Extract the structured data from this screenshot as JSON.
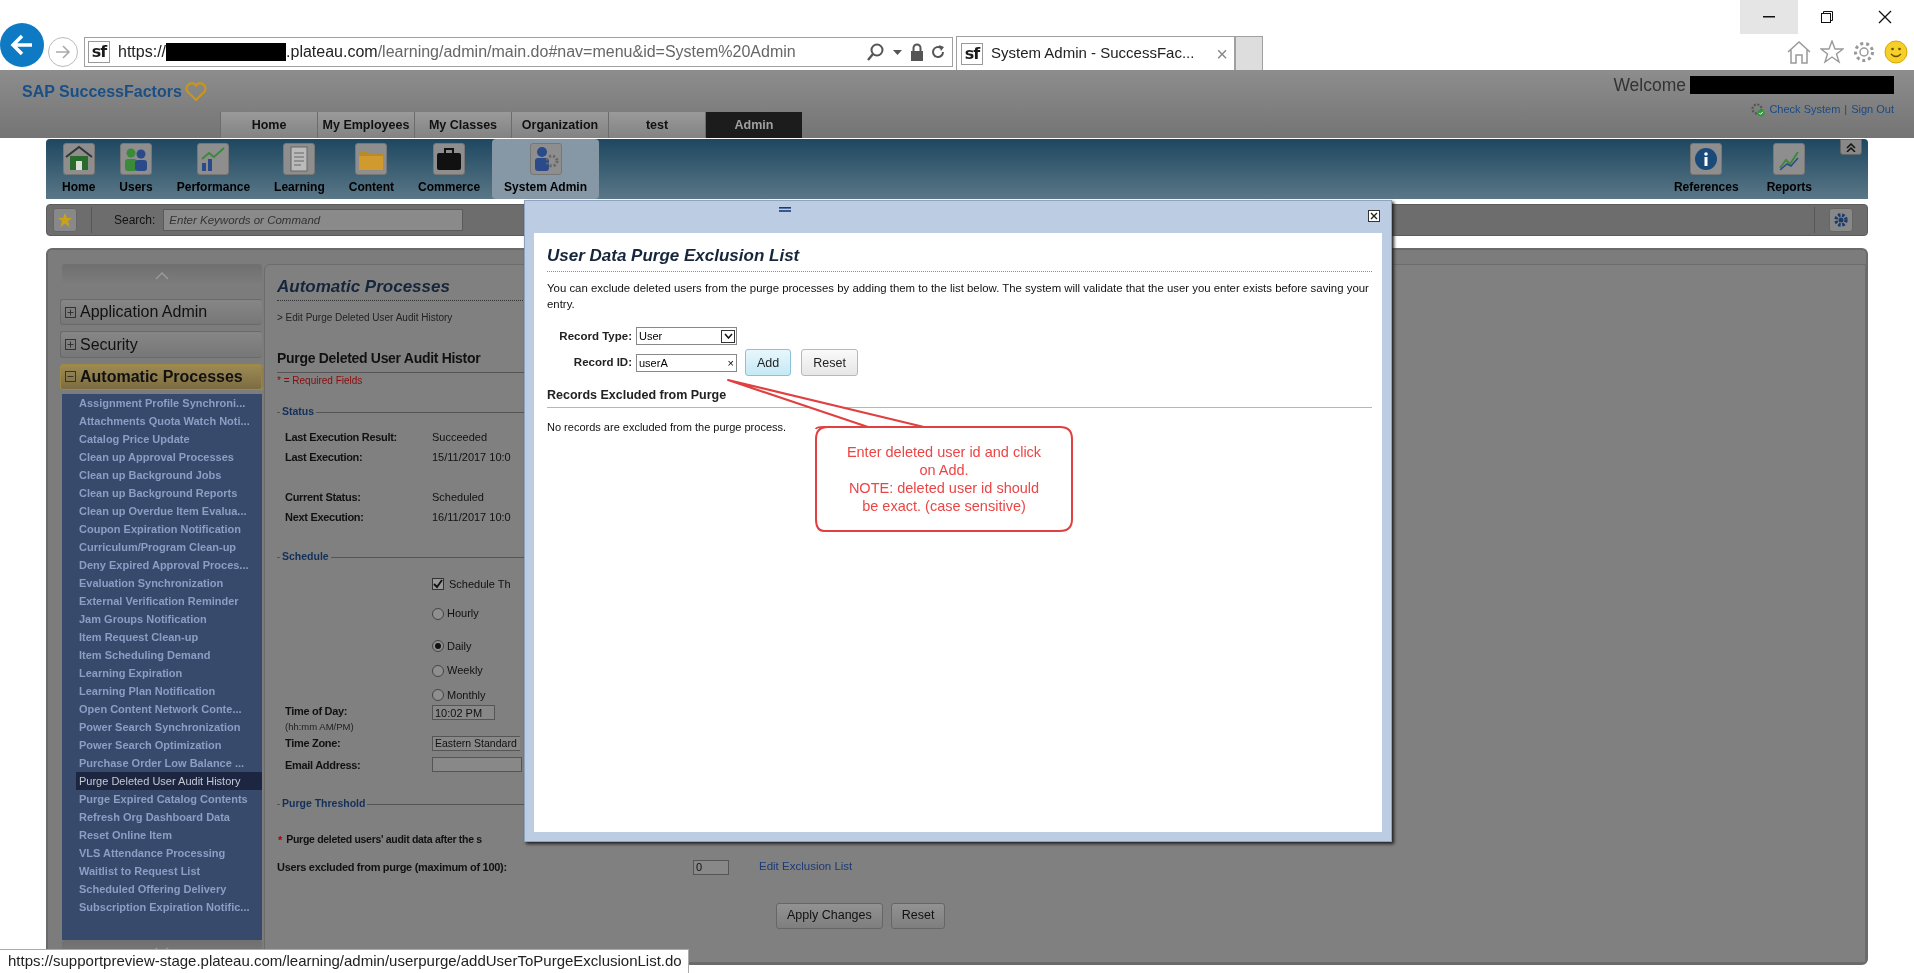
{
  "browser": {
    "address": {
      "site_icon": "sf",
      "scheme": "https://",
      "host": ".plateau.com",
      "path": "/learning/admin/main.do#nav=menu&id=System%20Admin"
    },
    "tabs": [
      {
        "site_icon": "sf",
        "title": "System Admin - SuccessFac...",
        "close": "×",
        "selected": true
      }
    ]
  },
  "header": {
    "logo": "SAP SuccessFactors",
    "welcome": "Welcome",
    "links": [
      "Check System",
      "Sign Out"
    ],
    "separator": "|"
  },
  "nav_tabs": [
    {
      "label": "Home",
      "selected": false
    },
    {
      "label": "My Employees",
      "selected": false
    },
    {
      "label": "My Classes",
      "selected": false
    },
    {
      "label": "Organization",
      "selected": false
    },
    {
      "label": "test",
      "selected": false
    },
    {
      "label": "Admin",
      "selected": true
    }
  ],
  "toolbar": {
    "items": [
      {
        "label": "Home",
        "selected": false
      },
      {
        "label": "Users",
        "selected": false
      },
      {
        "label": "Performance",
        "selected": false
      },
      {
        "label": "Learning",
        "selected": false
      },
      {
        "label": "Content",
        "selected": false
      },
      {
        "label": "Commerce",
        "selected": false
      },
      {
        "label": "System Admin",
        "selected": true
      }
    ],
    "right_items": [
      "References",
      "Reports"
    ]
  },
  "search": {
    "label": "Search:",
    "placeholder": "Enter Keywords or Command"
  },
  "sidebar": {
    "sections": [
      {
        "label": "Application Admin",
        "expanded": false
      },
      {
        "label": "Security",
        "expanded": false
      },
      {
        "label": "Automatic Processes",
        "expanded": true,
        "children": [
          {
            "label": "Assignment Profile Synchroni...",
            "selected": false
          },
          {
            "label": "Attachments Quota Watch Noti...",
            "selected": false
          },
          {
            "label": "Catalog Price Update",
            "selected": false
          },
          {
            "label": "Clean up Approval Processes",
            "selected": false
          },
          {
            "label": "Clean up Background Jobs",
            "selected": false
          },
          {
            "label": "Clean up Background Reports",
            "selected": false
          },
          {
            "label": "Clean up Overdue Item Evalua...",
            "selected": false
          },
          {
            "label": "Coupon Expiration Notification",
            "selected": false
          },
          {
            "label": "Curriculum/Program Clean-up",
            "selected": false
          },
          {
            "label": "Deny Expired Approval Proces...",
            "selected": false
          },
          {
            "label": "Evaluation Synchronization",
            "selected": false
          },
          {
            "label": "External Verification Reminder",
            "selected": false
          },
          {
            "label": "Jam Groups Notification",
            "selected": false
          },
          {
            "label": "Item Request Clean-up",
            "selected": false
          },
          {
            "label": "Item Scheduling Demand",
            "selected": false
          },
          {
            "label": "Learning Expiration",
            "selected": false
          },
          {
            "label": "Learning Plan Notification",
            "selected": false
          },
          {
            "label": "Open Content Network Conte...",
            "selected": false
          },
          {
            "label": "Power Search Synchronization",
            "selected": false
          },
          {
            "label": "Power Search Optimization",
            "selected": false
          },
          {
            "label": "Purchase Order Low Balance ...",
            "selected": false
          },
          {
            "label": "Purge Deleted User Audit History",
            "selected": true
          },
          {
            "label": "Purge Expired Catalog Contents",
            "selected": false
          },
          {
            "label": "Refresh Org Dashboard Data",
            "selected": false
          },
          {
            "label": "Reset Online Item",
            "selected": false
          },
          {
            "label": "VLS Attendance Processing",
            "selected": false
          },
          {
            "label": "Waitlist to Request List",
            "selected": false
          },
          {
            "label": "Scheduled Offering Delivery",
            "selected": false
          },
          {
            "label": "Subscription Expiration Notific...",
            "selected": false
          }
        ]
      }
    ]
  },
  "main": {
    "title": "Automatic Processes",
    "breadcrumb": "> Edit Purge Deleted User Audit History",
    "heading": "Purge Deleted User Audit Histor",
    "required_note": "* = Required Fields",
    "status": {
      "legend": "Status",
      "rows": [
        {
          "label": "Last Execution Result:",
          "value": "Succeeded"
        },
        {
          "label": "Last Execution:",
          "value": "15/11/2017 10:0"
        },
        {
          "label": "Current Status:",
          "value": "Scheduled"
        },
        {
          "label": "Next Execution:",
          "value": "16/11/2017 10:0"
        }
      ]
    },
    "schedule": {
      "legend": "Schedule",
      "checkbox": {
        "label": "Schedule Th",
        "checked": true
      },
      "frequency": [
        {
          "label": "Hourly",
          "selected": false
        },
        {
          "label": "Daily",
          "selected": true
        },
        {
          "label": "Weekly",
          "selected": false
        },
        {
          "label": "Monthly",
          "selected": false
        }
      ],
      "time_of_day": {
        "label": "Time of Day:",
        "hint": "(hh:mm AM/PM)",
        "value": "10:02 PM"
      },
      "time_zone": {
        "label": "Time Zone:",
        "value": "Eastern Standard"
      },
      "email": {
        "label": "Email Address:"
      }
    },
    "threshold": {
      "legend": "Purge Threshold",
      "required_mark": "*",
      "purge_label": "Purge deleted users' audit data after the s",
      "excluded_label": "Users excluded from purge (maximum of 100):",
      "excluded_value": "0",
      "edit_link": "Edit Exclusion List"
    },
    "buttons": [
      "Apply Changes",
      "Reset"
    ]
  },
  "dialog": {
    "title": "User Data Purge Exclusion List",
    "description": "You can exclude deleted users from the purge processes by adding them to the list below. The system will validate that the user you enter exists before saving your entry.",
    "record_type": {
      "label": "Record Type:",
      "value": "User"
    },
    "record_id": {
      "label": "Record ID:",
      "value": "userA",
      "clear": "×"
    },
    "buttons": [
      "Add",
      "Reset"
    ],
    "list_heading": "Records Excluded from Purge",
    "empty_text": "No records are excluded from the purge process."
  },
  "callout": {
    "lines": [
      "Enter deleted user id and click on Add.",
      "NOTE: deleted user id should be exact. (case sensitive)"
    ]
  },
  "status_url": "https://supportpreview-stage.plateau.com/learning/admin/userpurge/addUserToPurgeExclusionList.do"
}
